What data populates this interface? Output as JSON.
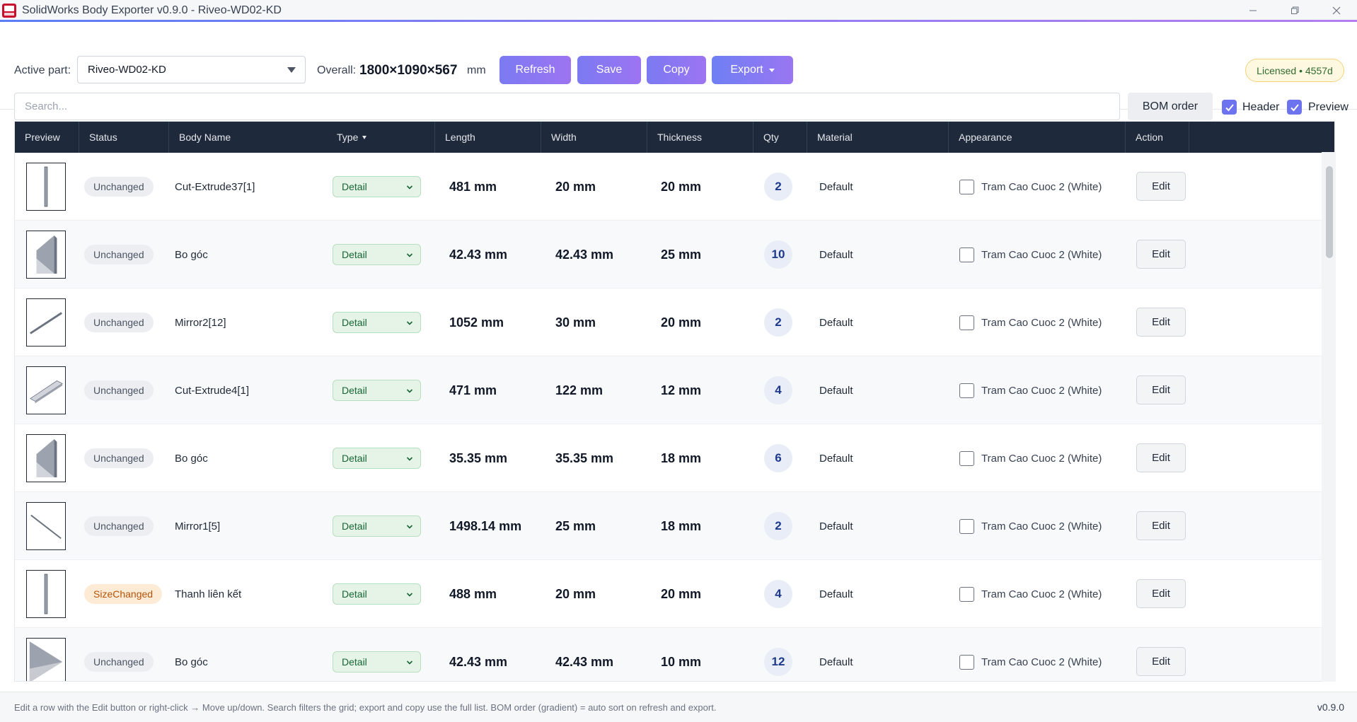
{
  "window": {
    "title": "SolidWorks Body Exporter v0.9.0 - Riveo-WD02-KD",
    "controls": [
      "minimize-icon",
      "restore-icon",
      "close-icon"
    ]
  },
  "toolbar": {
    "active_part_label": "Active part:",
    "active_part_value": "Riveo-WD02-KD",
    "overall_label": "Overall:",
    "overall_value": "1800×1090×567",
    "overall_unit": "mm",
    "refresh_label": "Refresh",
    "save_label": "Save",
    "copy_label": "Copy",
    "export_label": "Export",
    "license_label": "Licensed • 4557d",
    "search_placeholder": "Search...",
    "bom_label": "BOM order",
    "header_label": "Header",
    "preview_label": "Preview",
    "header_checked": true,
    "preview_checked": true
  },
  "grid": {
    "columns": [
      "Preview",
      "Status",
      "Body Name",
      "Type",
      "Length",
      "Width",
      "Thickness",
      "Qty",
      "Material",
      "Appearance",
      "Action"
    ],
    "rows": [
      {
        "preview": "vertical-bar",
        "status": "Unchanged",
        "name": "Cut-Extrude37[1]",
        "type": "Detail",
        "length": "481 mm",
        "width": "20 mm",
        "thickness": "20 mm",
        "qty": "2",
        "material": "Default",
        "appearance": "Tram Cao Cuoc 2 (White)",
        "action": "Edit"
      },
      {
        "preview": "corner-block",
        "status": "Unchanged",
        "name": "Bo góc",
        "type": "Detail",
        "length": "42.43 mm",
        "width": "42.43 mm",
        "thickness": "25 mm",
        "qty": "10",
        "material": "Default",
        "appearance": "Tram Cao Cuoc 2 (White)",
        "action": "Edit"
      },
      {
        "preview": "diagonal-bar",
        "status": "Unchanged",
        "name": "Mirror2[12]",
        "type": "Detail",
        "length": "1052 mm",
        "width": "30 mm",
        "thickness": "20 mm",
        "qty": "2",
        "material": "Default",
        "appearance": "Tram Cao Cuoc 2 (White)",
        "action": "Edit"
      },
      {
        "preview": "flat-plate",
        "status": "Unchanged",
        "name": "Cut-Extrude4[1]",
        "type": "Detail",
        "length": "471 mm",
        "width": "122 mm",
        "thickness": "12 mm",
        "qty": "4",
        "material": "Default",
        "appearance": "Tram Cao Cuoc 2 (White)",
        "action": "Edit"
      },
      {
        "preview": "corner-block",
        "status": "Unchanged",
        "name": "Bo góc",
        "type": "Detail",
        "length": "35.35 mm",
        "width": "35.35 mm",
        "thickness": "18 mm",
        "qty": "6",
        "material": "Default",
        "appearance": "Tram Cao Cuoc 2 (White)",
        "action": "Edit"
      },
      {
        "preview": "diagonal-bar-down",
        "status": "Unchanged",
        "name": "Mirror1[5]",
        "type": "Detail",
        "length": "1498.14 mm",
        "width": "25 mm",
        "thickness": "18 mm",
        "qty": "2",
        "material": "Default",
        "appearance": "Tram Cao Cuoc 2 (White)",
        "action": "Edit"
      },
      {
        "preview": "vertical-bar",
        "status": "SizeChanged",
        "name": "Thanh liên kết",
        "type": "Detail",
        "length": "488 mm",
        "width": "20 mm",
        "thickness": "20 mm",
        "qty": "4",
        "material": "Default",
        "appearance": "Tram Cao Cuoc 2 (White)",
        "action": "Edit"
      },
      {
        "preview": "triangle-block",
        "status": "Unchanged",
        "name": "Bo góc",
        "type": "Detail",
        "length": "42.43 mm",
        "width": "42.43 mm",
        "thickness": "10 mm",
        "qty": "12",
        "material": "Default",
        "appearance": "Tram Cao Cuoc 2 (White)",
        "action": "Edit"
      }
    ]
  },
  "footer": {
    "hint": "Edit a row with the Edit button or right-click → Move up/down. Search filters the grid; export and copy use the full list. BOM order (gradient) = auto sort on refresh and export.",
    "version": "v0.9.0"
  }
}
